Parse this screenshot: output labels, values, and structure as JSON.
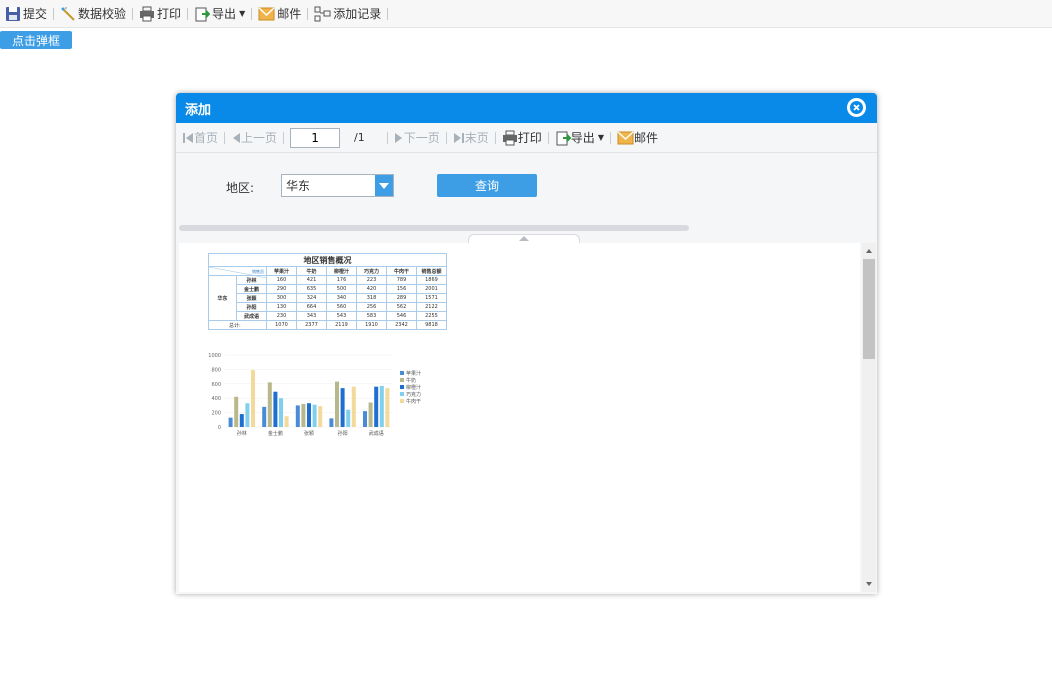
{
  "toolbar": {
    "submit": "提交",
    "validate": "数据校验",
    "print": "打印",
    "export": "导出",
    "mail": "邮件",
    "add_record": "添加记录"
  },
  "popup_button": "点击弹框",
  "dialog": {
    "title": "添加",
    "nav": {
      "first": "首页",
      "prev": "上一页",
      "page_value": "1",
      "page_total": "/1",
      "next": "下一页",
      "last": "末页",
      "print": "打印",
      "export": "导出",
      "mail": "邮件"
    },
    "param": {
      "label": "地区:",
      "value": "华东",
      "query": "查询"
    }
  },
  "report": {
    "title": "地区销售概况",
    "corner": "销售员",
    "headers": [
      "苹果汁",
      "牛奶",
      "柳橙汁",
      "巧克力",
      "牛肉干",
      "销售总额"
    ],
    "region": "华东",
    "rows": [
      {
        "name": "孙林",
        "values": [
          "160",
          "421",
          "176",
          "223",
          "789",
          "1869"
        ]
      },
      {
        "name": "金士鹏",
        "values": [
          "290",
          "635",
          "500",
          "420",
          "156",
          "2001"
        ]
      },
      {
        "name": "张颖",
        "values": [
          "300",
          "324",
          "340",
          "318",
          "289",
          "1571"
        ]
      },
      {
        "name": "孙阳",
        "values": [
          "130",
          "664",
          "560",
          "256",
          "562",
          "2122"
        ]
      },
      {
        "name": "武成语",
        "values": [
          "230",
          "343",
          "543",
          "583",
          "546",
          "2255"
        ]
      }
    ],
    "total_label": "总计:",
    "totals": [
      "1070",
      "2377",
      "2119",
      "1910",
      "2342",
      "9818"
    ]
  },
  "chart_data": {
    "type": "bar",
    "categories": [
      "孙林",
      "金士鹏",
      "张颖",
      "孙阳",
      "武成语"
    ],
    "ylim": [
      0,
      1000
    ],
    "yticks": [
      0,
      200,
      400,
      600,
      800,
      1000
    ],
    "legend_position": "right",
    "series": [
      {
        "name": "苹果汁",
        "color": "#4a8bd8",
        "values": [
          130,
          280,
          300,
          120,
          220
        ]
      },
      {
        "name": "牛奶",
        "color": "#b8b88a",
        "values": [
          420,
          620,
          320,
          630,
          340
        ]
      },
      {
        "name": "柳橙汁",
        "color": "#1f6fd0",
        "values": [
          180,
          490,
          330,
          540,
          560
        ]
      },
      {
        "name": "巧克力",
        "color": "#7fd0ee",
        "values": [
          330,
          400,
          310,
          240,
          570
        ]
      },
      {
        "name": "牛肉干",
        "color": "#f3d99a",
        "values": [
          790,
          150,
          290,
          560,
          540
        ]
      }
    ]
  }
}
